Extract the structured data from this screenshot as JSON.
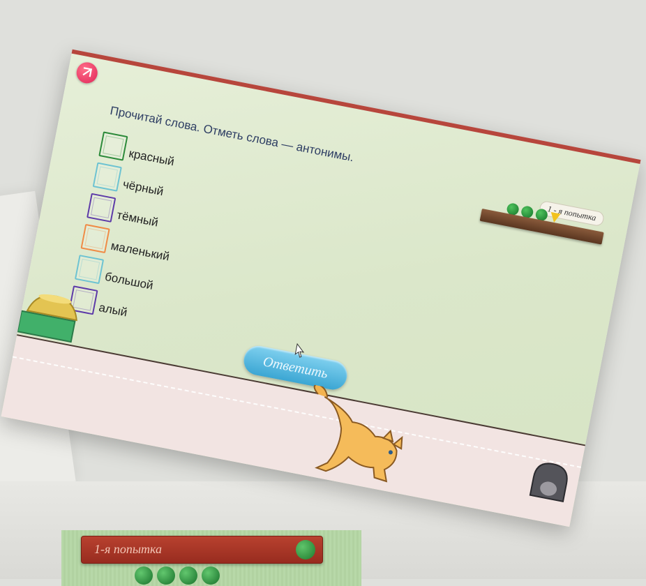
{
  "app": {
    "instruction": "Прочитай слова. Отметь слова — антонимы.",
    "attempt_label": "1 - я попытка",
    "answer_button": "Ответить"
  },
  "options": [
    {
      "label": "красный",
      "color": "#2c8a3a"
    },
    {
      "label": "чёрный",
      "color": "#6dc3d2"
    },
    {
      "label": "тёмный",
      "color": "#5d3aa8"
    },
    {
      "label": "маленький",
      "color": "#f08b46"
    },
    {
      "label": "большой",
      "color": "#6dc3d2"
    },
    {
      "label": "алый",
      "color": "#5d3aa8"
    }
  ],
  "attempts": {
    "balls_remaining": 3,
    "ball_color": "#2ea03f"
  },
  "second_screen": {
    "attempt_label": "1-я попытка"
  },
  "colors": {
    "accent_red": "#b7463c",
    "answer_button": "#4fb3dc",
    "home_button": "#e8336a"
  }
}
